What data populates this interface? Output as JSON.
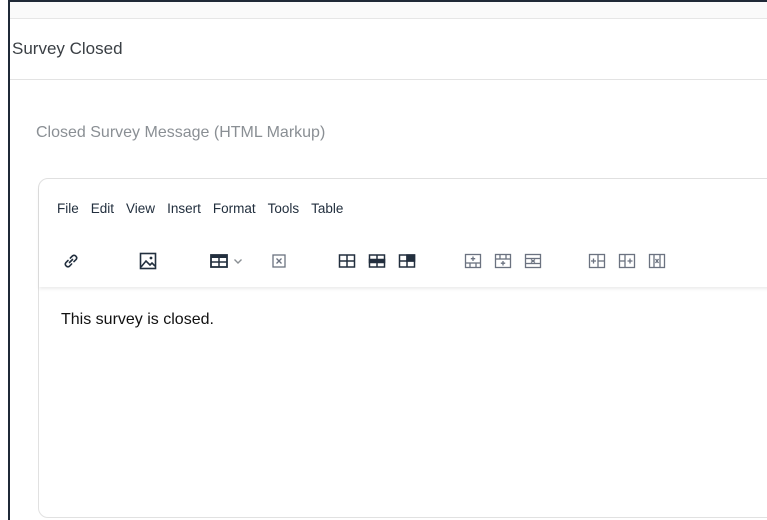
{
  "section": {
    "title": "Survey Closed"
  },
  "field": {
    "label": "Closed Survey Message (HTML Markup)"
  },
  "editor": {
    "menu": [
      "File",
      "Edit",
      "View",
      "Insert",
      "Format",
      "Tools",
      "Table"
    ],
    "content": "This survey is closed."
  },
  "toolbar": {
    "icons": [
      "link-icon",
      "image-icon",
      "table-icon",
      "chevron-down-icon",
      "delete-table-icon",
      "table-properties-icon",
      "table-row-properties-icon",
      "table-cell-properties-icon",
      "insert-row-before-icon",
      "insert-row-after-icon",
      "delete-row-icon",
      "insert-column-before-icon",
      "insert-column-after-icon",
      "delete-column-icon"
    ]
  }
}
